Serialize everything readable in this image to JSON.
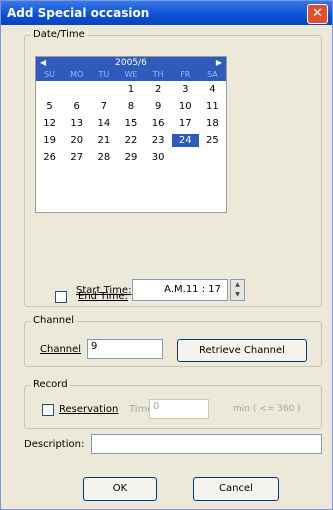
{
  "window": {
    "title": "Add Special occasion",
    "close_glyph": "✕"
  },
  "datetime": {
    "group_label": "Date/Time",
    "calendar": {
      "month_label": "2005/6",
      "prev_glyph": "◀",
      "next_glyph": "▶",
      "weekdays": [
        "SU",
        "MO",
        "TU",
        "WE",
        "TH",
        "FR",
        "SA"
      ],
      "days": [
        "",
        "",
        "",
        "1",
        "2",
        "3",
        "4",
        "5",
        "6",
        "7",
        "8",
        "9",
        "10",
        "11",
        "12",
        "13",
        "14",
        "15",
        "16",
        "17",
        "18",
        "19",
        "20",
        "21",
        "22",
        "23",
        "24",
        "25",
        "26",
        "27",
        "28",
        "29",
        "30",
        "",
        ""
      ],
      "selected_day": "24"
    },
    "start_time_label": "Start Time:",
    "start_time_value": "A.M.11 : 17",
    "end_time_label": "End Time:"
  },
  "channel": {
    "group_label": "Channel",
    "label": "Channel",
    "value": "9",
    "retrieve_button": "Retrieve Channel"
  },
  "record": {
    "group_label": "Record",
    "reservation_label": "Reservation",
    "time_label": "Time",
    "time_value": "0",
    "time_hint": "min ( <= 360 )"
  },
  "description": {
    "label": "Description:",
    "value": ""
  },
  "buttons": {
    "ok": "OK",
    "cancel": "Cancel"
  },
  "colors": {
    "title_bar": "#0a4fd6",
    "calendar_header": "#2f5bbd",
    "close_button": "#e0502f"
  }
}
